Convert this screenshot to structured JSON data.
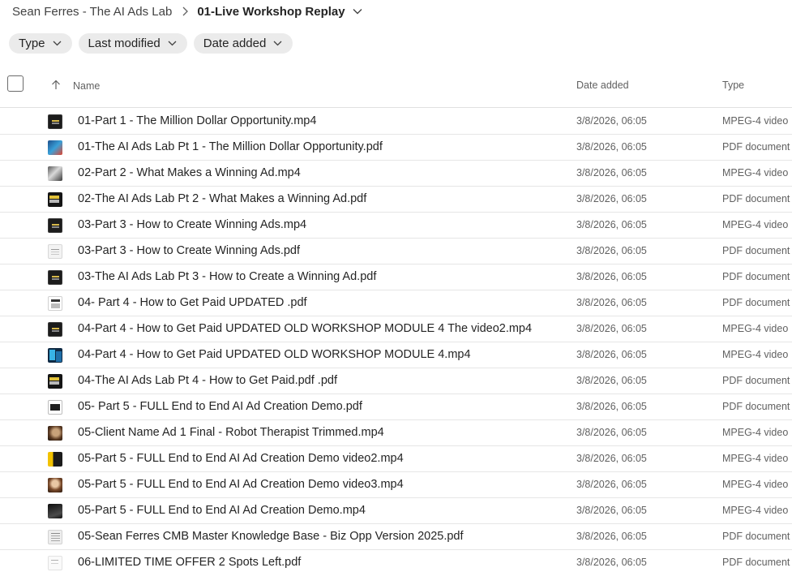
{
  "breadcrumb": {
    "root": "Sean Ferres - The AI Ads Lab",
    "current": "01-Live Workshop Replay",
    "separator_icon": "chevron-right-icon",
    "dropdown_icon": "chevron-down-icon"
  },
  "filters": [
    {
      "label": "Type",
      "icon": "chevron-down-icon"
    },
    {
      "label": "Last modified",
      "icon": "chevron-down-icon"
    },
    {
      "label": "Date added",
      "icon": "chevron-down-icon"
    }
  ],
  "columns": {
    "sort_icon": "arrow-up-icon",
    "name": "Name",
    "date_added": "Date added",
    "type": "Type"
  },
  "files": [
    {
      "thumb": "t-dark",
      "name": "01-Part 1 - The Million Dollar Opportunity.mp4",
      "date_added": "3/8/2026, 06:05",
      "type": "MPEG-4 video"
    },
    {
      "thumb": "t-blue",
      "name": "01-The AI Ads Lab Pt 1 - The Million Dollar Opportunity.pdf",
      "date_added": "3/8/2026, 06:05",
      "type": "PDF document"
    },
    {
      "thumb": "t-photo",
      "name": "02-Part 2 - What Makes a Winning Ad.mp4",
      "date_added": "3/8/2026, 06:05",
      "type": "MPEG-4 video"
    },
    {
      "thumb": "t-yellow",
      "name": "02-The AI Ads Lab Pt 2 - What Makes a Winning Ad.pdf",
      "date_added": "3/8/2026, 06:05",
      "type": "PDF document"
    },
    {
      "thumb": "t-dark",
      "name": "03-Part 3 - How to Create Winning Ads.mp4",
      "date_added": "3/8/2026, 06:05",
      "type": "MPEG-4 video"
    },
    {
      "thumb": "t-light",
      "name": "03-Part 3 - How to Create Winning Ads.pdf",
      "date_added": "3/8/2026, 06:05",
      "type": "PDF document"
    },
    {
      "thumb": "t-dark",
      "name": "03-The AI Ads Lab Pt 3 - How to Create a Winning Ad.pdf",
      "date_added": "3/8/2026, 06:05",
      "type": "PDF document"
    },
    {
      "thumb": "t-doc",
      "name": "04- Part 4 - How to Get Paid UPDATED .pdf",
      "date_added": "3/8/2026, 06:05",
      "type": "PDF document"
    },
    {
      "thumb": "t-dark",
      "name": "04-Part 4 - How to Get Paid UPDATED OLD WORKSHOP MODULE 4 The video2.mp4",
      "date_added": "3/8/2026, 06:05",
      "type": "MPEG-4 video"
    },
    {
      "thumb": "t-cyan",
      "name": "04-Part 4 - How to Get Paid UPDATED OLD WORKSHOP MODULE 4.mp4",
      "date_added": "3/8/2026, 06:05",
      "type": "MPEG-4 video"
    },
    {
      "thumb": "t-yellow",
      "name": "04-The AI Ads Lab Pt 4 - How to Get Paid.pdf .pdf",
      "date_added": "3/8/2026, 06:05",
      "type": "PDF document"
    },
    {
      "thumb": "t-frame",
      "name": "05- Part 5 - FULL End to End AI Ad Creation Demo.pdf",
      "date_added": "3/8/2026, 06:05",
      "type": "PDF document"
    },
    {
      "thumb": "t-robot",
      "name": "05-Client Name Ad 1 Final - Robot Therapist Trimmed.mp4",
      "date_added": "3/8/2026, 06:05",
      "type": "MPEG-4 video"
    },
    {
      "thumb": "t-split",
      "name": "05-Part 5 - FULL End to End AI Ad Creation Demo video2.mp4",
      "date_added": "3/8/2026, 06:05",
      "type": "MPEG-4 video"
    },
    {
      "thumb": "t-face",
      "name": "05-Part 5 - FULL End to End AI Ad Creation Demo video3.mp4",
      "date_added": "3/8/2026, 06:05",
      "type": "MPEG-4 video"
    },
    {
      "thumb": "t-mono",
      "name": "05-Part 5 - FULL End to End AI Ad Creation Demo.mp4",
      "date_added": "3/8/2026, 06:05",
      "type": "MPEG-4 video"
    },
    {
      "thumb": "t-paper",
      "name": "05-Sean Ferres CMB Master Knowledge Base - Biz Opp Version 2025.pdf",
      "date_added": "3/8/2026, 06:05",
      "type": "PDF document"
    },
    {
      "thumb": "t-blank",
      "name": "06-LIMITED TIME OFFER 2 Spots Left.pdf",
      "date_added": "3/8/2026, 06:05",
      "type": "PDF document"
    }
  ]
}
